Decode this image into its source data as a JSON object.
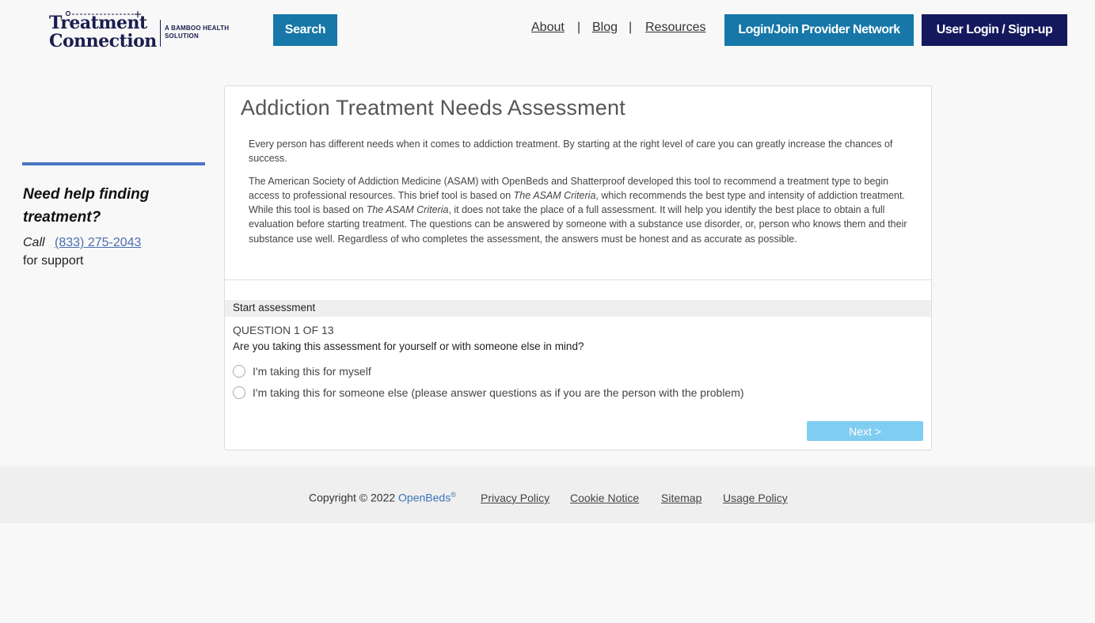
{
  "header": {
    "logo": {
      "line1": "Treatment",
      "line2": "Connection",
      "tag_line1": "A BAMBOO HEALTH",
      "tag_line2": "SOLUTION"
    },
    "search_label": "Search",
    "nav": {
      "about": "About",
      "separator": "|",
      "blog": "Blog",
      "resources": "Resources"
    },
    "provider_label": "Login/Join Provider Network",
    "user_label": "User Login / Sign-up"
  },
  "sidebar": {
    "heading": "Need help finding treatment?",
    "call_label": "Call",
    "phone": "(833) 275-2043",
    "support": "for support"
  },
  "main": {
    "title": "Addiction Treatment Needs Assessment",
    "intro1": "Every person has different needs when it comes to addiction treatment. By starting at the right level of care you can greatly increase the chances of success.",
    "intro2_a": "The American Society of Addiction Medicine (ASAM) with OpenBeds and Shatterproof developed this tool to recommend a treatment type to begin access to professional resources. This brief tool is based on ",
    "intro2_b": "The ASAM Criteria",
    "intro2_c": ", which recommends the best type and intensity of addiction treatment. While this tool is based on ",
    "intro2_d": "The ASAM Criteria",
    "intro2_e": ", it does not take the place of a full assessment. It will help you identify the best place to obtain a full evaluation before starting treatment. The questions can be answered by someone with a substance use disorder, or, person who knows them and their substance use well. Regardless of who completes the assessment, the answers must be honest and as accurate as possible.",
    "start_label": "Start assessment",
    "question_count": "QUESTION 1 OF 13",
    "question": "Are you taking this assessment for yourself or with someone else in mind?",
    "options": [
      "I'm taking this for myself",
      "I'm taking this for someone else (please answer questions as if you are the person with the problem)"
    ],
    "next_label": "Next >"
  },
  "footer": {
    "copyright": "Copyright © 2022 ",
    "brand": "OpenBeds",
    "reg": "®",
    "links": {
      "privacy": "Privacy Policy",
      "cookie": "Cookie Notice",
      "sitemap": "Sitemap",
      "usage": "Usage Policy"
    }
  },
  "colors": {
    "primary_blue": "#1677a8",
    "navy": "#14195e",
    "next_disabled": "#80cdf2",
    "sidebar_accent": "#4a76c4"
  }
}
